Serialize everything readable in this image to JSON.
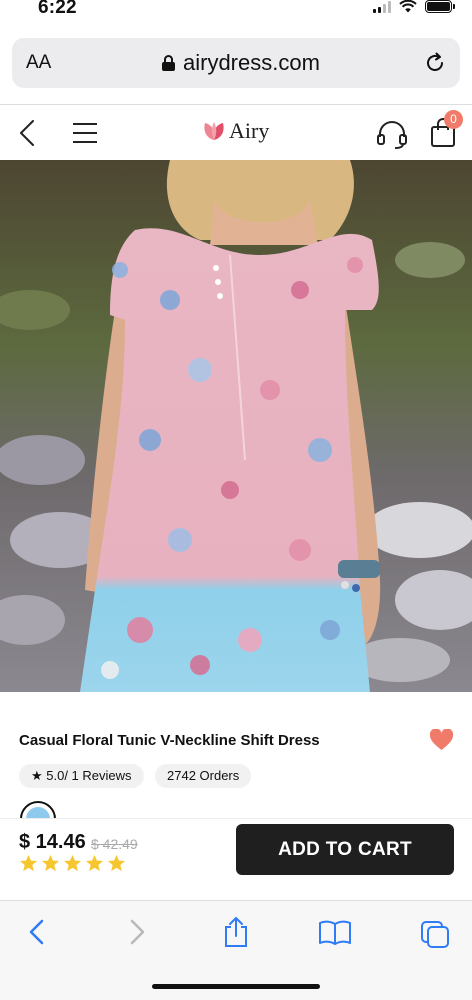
{
  "status_bar": {
    "time": "6:22"
  },
  "browser": {
    "text_size_label": "AA",
    "url": "airydress.com"
  },
  "header": {
    "brand": "Airy",
    "cart_count": "0"
  },
  "product": {
    "title": "Casual Floral Tunic V-Neckline Shift Dress",
    "rating_label": "★ 5.0/ 1 Reviews",
    "orders_label": "2742 Orders",
    "selected_color": "#8ec9ee",
    "price": "$ 14.46",
    "original_price": "$ 42.49",
    "star_rating": 5,
    "add_to_cart_label": "ADD TO CART"
  },
  "colors": {
    "accent": "#f07b6a",
    "button_bg": "#1f1f1f",
    "safari_blue": "#2f7cf6",
    "star_yellow": "#f7c62f"
  },
  "icons": [
    "back-icon",
    "menu-icon",
    "brand-logo-icon",
    "support-headset-icon",
    "shopping-bag-icon",
    "heart-icon",
    "lock-icon",
    "reload-icon",
    "share-icon",
    "bookmarks-icon",
    "tabs-icon"
  ]
}
